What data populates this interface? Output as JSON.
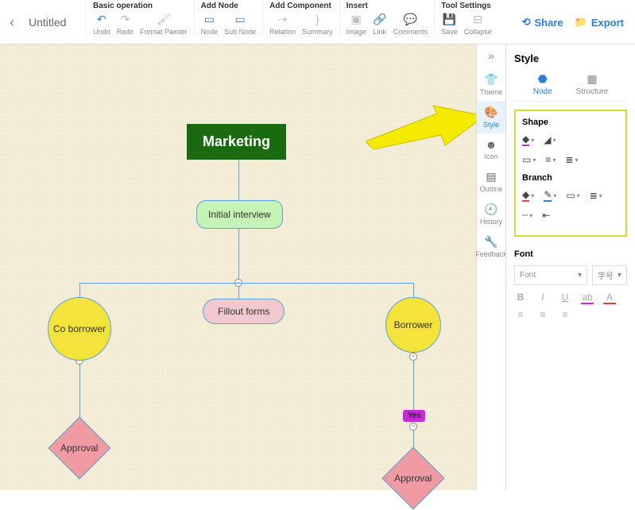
{
  "doc": {
    "title": "Untitled"
  },
  "toolbar": {
    "groups": [
      {
        "label": "Basic operation",
        "items": [
          {
            "name": "undo",
            "label": "Undo",
            "glyph": "↶",
            "color": "#2a7fd8"
          },
          {
            "name": "redo",
            "label": "Redo",
            "glyph": "↷",
            "color": "#bbb"
          },
          {
            "name": "format-painter",
            "label": "Format Painter",
            "glyph": "🖌",
            "color": "#bbb"
          }
        ]
      },
      {
        "label": "Add Node",
        "items": [
          {
            "name": "node",
            "label": "Node",
            "glyph": "▭",
            "color": "#2a7fd8"
          },
          {
            "name": "sub-node",
            "label": "Sub Node",
            "glyph": "▭",
            "color": "#2a7fd8"
          }
        ]
      },
      {
        "label": "Add Component",
        "items": [
          {
            "name": "relation",
            "label": "Relation",
            "glyph": "⇢",
            "color": "#bbb"
          },
          {
            "name": "summary",
            "label": "Summary",
            "glyph": "}",
            "color": "#bbb"
          }
        ]
      },
      {
        "label": "Insert",
        "items": [
          {
            "name": "image",
            "label": "Image",
            "glyph": "▣",
            "color": "#bbb"
          },
          {
            "name": "link",
            "label": "Link",
            "glyph": "🔗",
            "color": "#bbb"
          },
          {
            "name": "comments",
            "label": "Comments",
            "glyph": "💬",
            "color": "#bbb"
          }
        ]
      },
      {
        "label": "Tool Settings",
        "items": [
          {
            "name": "save",
            "label": "Save",
            "glyph": "💾",
            "color": "#2a7fd8"
          },
          {
            "name": "collapse",
            "label": "Collapse",
            "glyph": "⊟",
            "color": "#bbb"
          }
        ]
      }
    ],
    "share": "Share",
    "export": "Export"
  },
  "sidebar": {
    "items": [
      {
        "name": "theme",
        "label": "Theme",
        "glyph": "👕"
      },
      {
        "name": "style",
        "label": "Style",
        "glyph": "🎨",
        "active": true
      },
      {
        "name": "icon",
        "label": "Icon",
        "glyph": "☻"
      },
      {
        "name": "outline",
        "label": "Outline",
        "glyph": "▤"
      },
      {
        "name": "history",
        "label": "History",
        "glyph": "🕘"
      },
      {
        "name": "feedback",
        "label": "Feedback",
        "glyph": "🔧"
      }
    ]
  },
  "panel": {
    "title": "Style",
    "tabs": [
      {
        "name": "node",
        "label": "Node",
        "glyph": "⬣",
        "active": true
      },
      {
        "name": "structure",
        "label": "Structure",
        "glyph": "▦"
      }
    ],
    "shape": {
      "label": "Shape"
    },
    "branch": {
      "label": "Branch"
    },
    "font": {
      "label": "Font",
      "selectLabel": "Font",
      "sizeLabel": "字号"
    }
  },
  "chart_data": {
    "type": "diagram",
    "nodes": [
      {
        "id": "root",
        "label": "Marketing",
        "shape": "rect",
        "fill": "#1a6b0f"
      },
      {
        "id": "n1",
        "label": "Initial interview",
        "shape": "rounded",
        "fill": "#c5f2b5",
        "parent": "root"
      },
      {
        "id": "n2",
        "label": "Fillout forms",
        "shape": "pill",
        "fill": "#f1c8cd",
        "parent": "n1"
      },
      {
        "id": "n3",
        "label": "Co borrower",
        "shape": "circle",
        "fill": "#f4e33a",
        "parent": "n2"
      },
      {
        "id": "n4",
        "label": "Borrower",
        "shape": "circle",
        "fill": "#f4e33a",
        "parent": "n2"
      },
      {
        "id": "n5",
        "label": "Approval",
        "shape": "diamond",
        "fill": "#f09aa4",
        "parent": "n3"
      },
      {
        "id": "n6",
        "label": "Yes",
        "shape": "tag",
        "fill": "#c42bd6",
        "parent": "n4"
      },
      {
        "id": "n7",
        "label": "Approval",
        "shape": "diamond",
        "fill": "#f09aa4",
        "parent": "n6"
      }
    ]
  }
}
